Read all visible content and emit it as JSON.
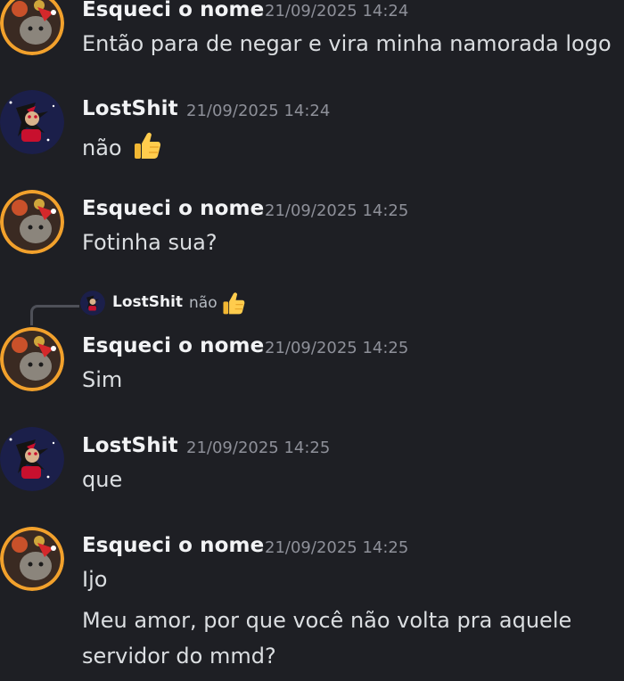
{
  "messages": [
    {
      "author": "Esqueci o nome",
      "timestamp": "21/09/2025 14:24",
      "avatar": "cat-santa-hat-fireworks-avatar",
      "lines": [
        "Então  para de negar e vira minha namorada logo"
      ]
    },
    {
      "author": "LostShit",
      "timestamp": "21/09/2025 14:24",
      "avatar": "shadow-hedgehog-avatar",
      "lines": [
        "não"
      ],
      "emoji": "thumbs-up-icon"
    },
    {
      "author": "Esqueci o nome",
      "timestamp": "21/09/2025 14:25",
      "avatar": "cat-santa-hat-fireworks-avatar",
      "lines": [
        "Fotinha sua?"
      ]
    },
    {
      "reply_to": {
        "author": "LostShit",
        "text": "não",
        "emoji": "thumbs-up-icon"
      },
      "author": "Esqueci o nome",
      "timestamp": "21/09/2025 14:25",
      "avatar": "cat-santa-hat-fireworks-avatar",
      "lines": [
        "Sim"
      ]
    },
    {
      "author": "LostShit",
      "timestamp": "21/09/2025 14:25",
      "avatar": "shadow-hedgehog-avatar",
      "lines": [
        "que"
      ]
    },
    {
      "author": "Esqueci o nome",
      "timestamp": "21/09/2025 14:25",
      "avatar": "cat-santa-hat-fireworks-avatar",
      "lines": [
        "Ijo",
        "Meu amor, por que você não volta pra aquele",
        "servidor do mmd?"
      ]
    }
  ],
  "colors": {
    "background": "#1e1f24",
    "author": "#f2f3f5",
    "timestamp": "#8e9099",
    "text": "#dbdee1"
  }
}
